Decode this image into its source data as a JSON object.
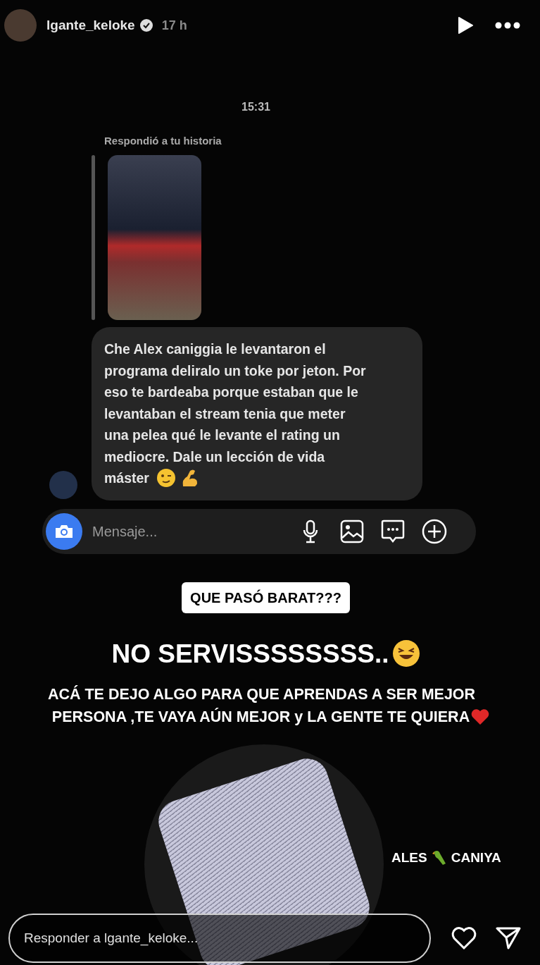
{
  "header": {
    "username": "lgante_keloke",
    "verified": true,
    "time": "17 h"
  },
  "chat": {
    "timestamp": "15:31",
    "reply_label": "Respondió a tu historia",
    "message_lines": [
      "Che Alex caniggia le levantaron el",
      "programa deliralo un toke por jeton. Por",
      "eso te bardeaba porque estaban que le",
      "levantaban el stream tenia que meter",
      "una pelea qué le levante el rating un",
      "mediocre. Dale un lección de vida",
      "máster"
    ],
    "composer": {
      "placeholder": "Mensaje..."
    }
  },
  "story_texts": {
    "caption": "QUE PASÓ BARAT???",
    "headline": "NO SERVISSSSSSSS..",
    "message_lines": [
      "ACÁ TE DEJO ALGO PARA QUE APRENDAS A SER MEJOR",
      "PERSONA ,TE VAYA AÚN MEJOR y LA GENTE TE QUIERA"
    ],
    "signature": [
      "ALES",
      "CANIYA"
    ]
  },
  "reply_bar": {
    "placeholder": "Responder a lgante_keloke..."
  }
}
